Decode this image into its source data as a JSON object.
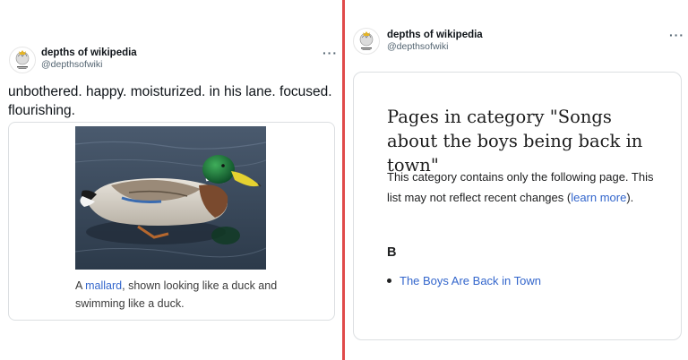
{
  "left_tweet": {
    "display_name": "depths of wikipedia",
    "handle": "@depthsofwiki",
    "more": "···",
    "text": "unbothered. happy. moisturized. in his lane. focused. flourishing.",
    "card": {
      "caption_prefix": "A ",
      "caption_link": "mallard",
      "caption_suffix": ", shown looking like a duck and swimming like a duck."
    }
  },
  "right_tweet": {
    "display_name": "depths of wikipedia",
    "handle": "@depthsofwiki",
    "more": "···",
    "card": {
      "title": "Pages in category \"Songs about the boys being back in town\"",
      "body_prefix": "This category contains only the following page. This list may not reflect recent changes (",
      "body_link": "learn more",
      "body_suffix": ").",
      "letter": "B",
      "items": [
        "The Boys Are Back in Town"
      ]
    }
  },
  "colors": {
    "divider": "#e04a4a",
    "link": "#3366cc",
    "handle": "#536471"
  },
  "icons": {
    "avatar": "wikipedia-globe-logo",
    "more": "more-options-icon"
  }
}
